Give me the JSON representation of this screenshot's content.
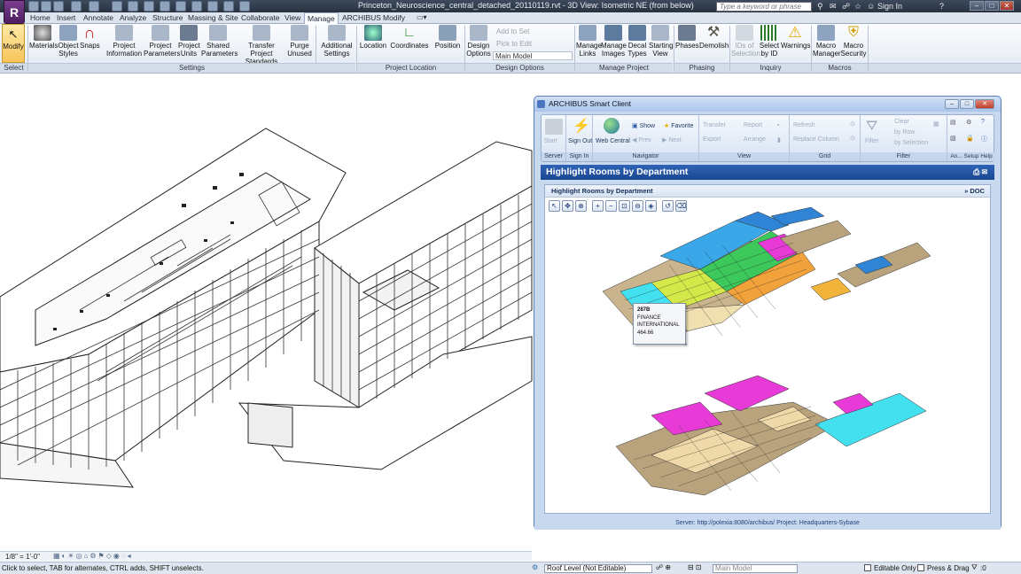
{
  "window": {
    "title": "Princeton_Neuroscience_central_detached_20110119.rvt - 3D View: Isometric NE (from below)",
    "search_placeholder": "Type a keyword or phrase",
    "sign_in": "Sign In",
    "app_letter": "R"
  },
  "tabs": [
    "Home",
    "Insert",
    "Annotate",
    "Analyze",
    "Structure",
    "Massing & Site",
    "Collaborate",
    "View",
    "Manage",
    "ARCHIBUS",
    "Modify"
  ],
  "active_tab": "Manage",
  "ribbon": {
    "select": {
      "modify": "Modify",
      "label": "Select"
    },
    "settings": {
      "buttons": [
        "Materials",
        "Object Styles",
        "Snaps",
        "Project Information",
        "Project Parameters",
        "Project Units",
        "Shared Parameters",
        "Transfer Project Standards",
        "Purge Unused",
        "Additional Settings"
      ],
      "label": "Settings"
    },
    "project_location": {
      "buttons": [
        "Location",
        "Coordinates",
        "Position"
      ],
      "label": "Project Location"
    },
    "design_options": {
      "button": "Design Options",
      "add_to_set": "Add to Set",
      "pick_to_edit": "Pick to Edit",
      "main_model": "Main Model",
      "label": "Design Options"
    },
    "manage_project": {
      "buttons": [
        "Manage Links",
        "Manage Images",
        "Decal Types",
        "Starting View"
      ],
      "label": "Manage Project"
    },
    "phasing": {
      "buttons": [
        "Phases",
        "Demolish"
      ],
      "label": "Phasing"
    },
    "inquiry": {
      "buttons": [
        "IDs of Selection",
        "Select by ID",
        "Warnings"
      ],
      "label": "Inquiry"
    },
    "macros": {
      "buttons": [
        "Macro Manager",
        "Macro Security"
      ],
      "label": "Macros"
    }
  },
  "archibus": {
    "title": "ARCHIBUS Smart Client",
    "groups": {
      "server": {
        "start": "Start",
        "label": "Server"
      },
      "signin": {
        "signout": "Sign Out",
        "label": "Sign In"
      },
      "navigator": {
        "web_central": "Web Central",
        "show": "Show",
        "favorite": "Favorite",
        "prev": "Prev",
        "next": "Next",
        "label": "Navigator"
      },
      "view": {
        "transfer": "Transfer",
        "report": "Report",
        "export": "Export",
        "arrange": "Arrange",
        "label": "View"
      },
      "grid": {
        "refresh": "Refresh",
        "replace_column": "Replace Column",
        "label": "Grid"
      },
      "filter": {
        "filter": "Filter",
        "clear": "Clear",
        "by_row": "by Row",
        "by_selection": "by Selection",
        "label": "Filter"
      },
      "misc": {
        "an": "An...",
        "setup": "Setup",
        "help": "Help"
      }
    },
    "view_header": "Highlight Rooms by Department",
    "panel_title": "Highlight Rooms by Department",
    "doc_link": "» DOC",
    "tooltip": {
      "room": "287B",
      "line1": "FINANCE",
      "line2": "INTERNATIONAL",
      "area": "464.66"
    },
    "footer": "Server: http://polexia:8080/archibus/  Project: Headquarters-Sybase"
  },
  "viewbar": {
    "scale": "1/8\" = 1'-0\""
  },
  "status": {
    "hint": "Click to select, TAB for alternates, CTRL adds, SHIFT unselects.",
    "level": "Roof Level (Not Editable)",
    "model": "Main Model",
    "editable_only": "Editable Only",
    "press_drag": "Press & Drag",
    "filter_count": ":0"
  },
  "colors": {
    "accent": "#1a4690",
    "dept_blue": "#3aa7e8",
    "dept_magenta": "#e83ad6",
    "dept_tan": "#b9a37d",
    "dept_cyan": "#43e0f0",
    "dept_green": "#3cc85a",
    "dept_orange": "#f2a23a"
  }
}
